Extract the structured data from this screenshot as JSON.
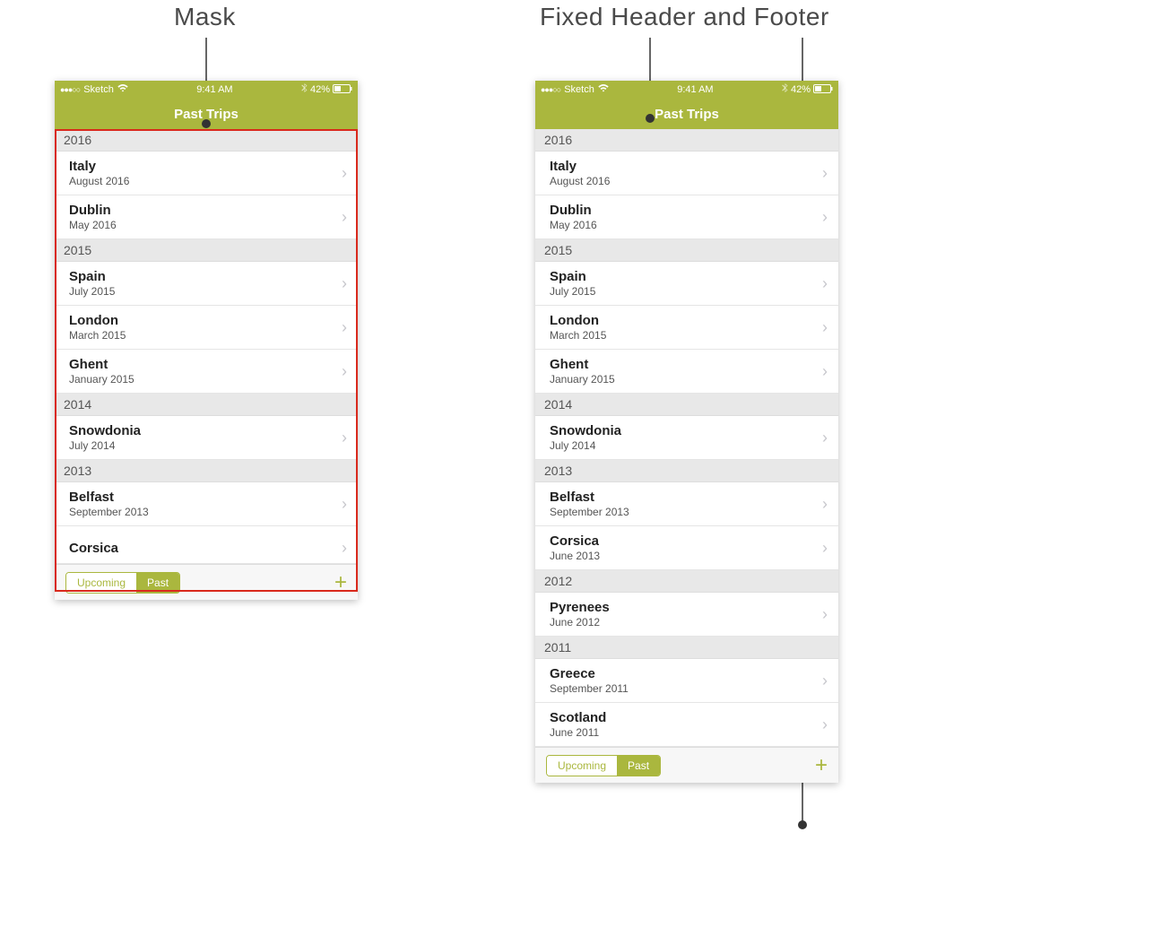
{
  "labels": {
    "mask": "Mask",
    "fixed": "Fixed Header and Footer"
  },
  "status": {
    "carrier": "Sketch",
    "time": "9:41 AM",
    "battery": "42%"
  },
  "header": {
    "title": "Past Trips"
  },
  "footer": {
    "seg_upcoming": "Upcoming",
    "seg_past": "Past"
  },
  "left_sections": [
    {
      "year": "2016",
      "rows": [
        {
          "title": "Italy",
          "sub": "August 2016"
        },
        {
          "title": "Dublin",
          "sub": "May 2016"
        }
      ]
    },
    {
      "year": "2015",
      "rows": [
        {
          "title": "Spain",
          "sub": "July 2015"
        },
        {
          "title": "London",
          "sub": "March 2015"
        },
        {
          "title": "Ghent",
          "sub": "January 2015"
        }
      ]
    },
    {
      "year": "2014",
      "rows": [
        {
          "title": "Snowdonia",
          "sub": "July 2014"
        }
      ]
    },
    {
      "year": "2013",
      "rows": [
        {
          "title": "Belfast",
          "sub": "September 2013"
        },
        {
          "title": "Corsica",
          "sub": "",
          "truncated": true
        }
      ]
    }
  ],
  "right_sections": [
    {
      "year": "2016",
      "rows": [
        {
          "title": "Italy",
          "sub": "August 2016"
        },
        {
          "title": "Dublin",
          "sub": "May 2016"
        }
      ]
    },
    {
      "year": "2015",
      "rows": [
        {
          "title": "Spain",
          "sub": "July 2015"
        },
        {
          "title": "London",
          "sub": "March 2015"
        },
        {
          "title": "Ghent",
          "sub": "January 2015"
        }
      ]
    },
    {
      "year": "2014",
      "rows": [
        {
          "title": "Snowdonia",
          "sub": "July 2014"
        }
      ]
    },
    {
      "year": "2013",
      "rows": [
        {
          "title": "Belfast",
          "sub": "September 2013"
        },
        {
          "title": "Corsica",
          "sub": "June 2013"
        }
      ]
    },
    {
      "year": "2012",
      "rows": [
        {
          "title": "Pyrenees",
          "sub": "June 2012"
        }
      ]
    },
    {
      "year": "2011",
      "rows": [
        {
          "title": "Greece",
          "sub": "September 2011"
        },
        {
          "title": "Scotland",
          "sub": "June 2011"
        }
      ]
    }
  ]
}
